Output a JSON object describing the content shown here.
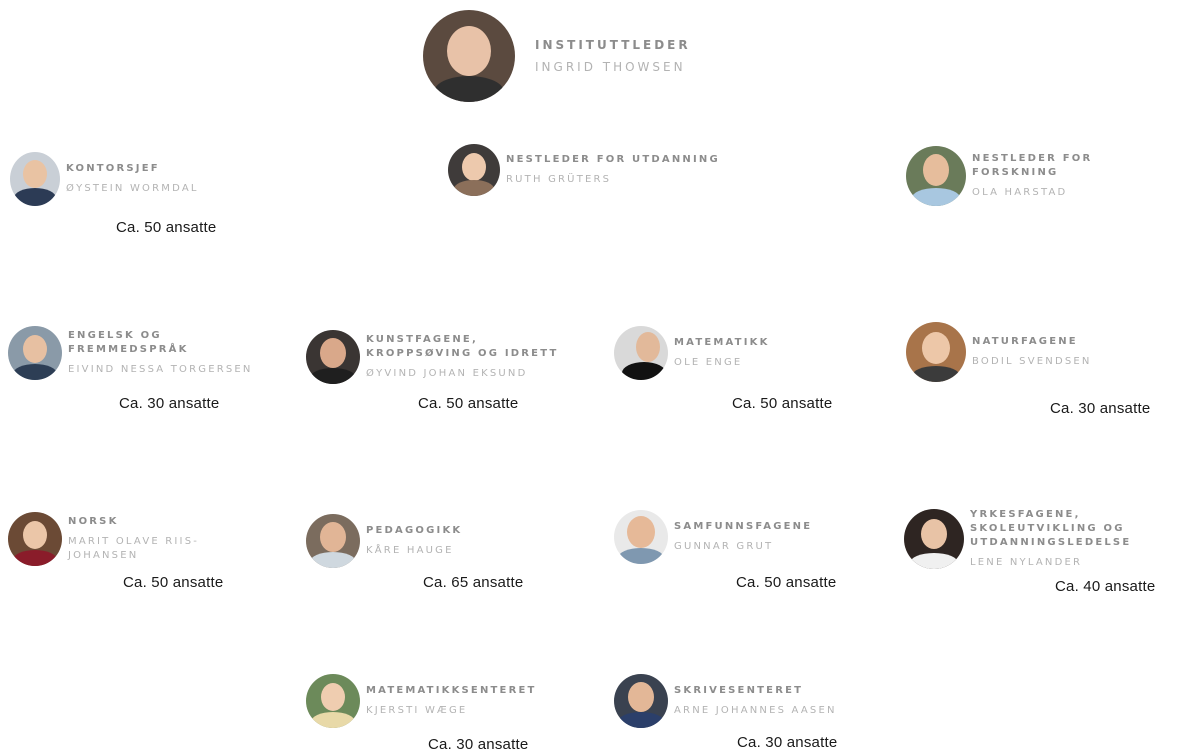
{
  "head": {
    "role": "INSTITUTTLEDER",
    "name": "INGRID THOWSEN",
    "avatar_icon": "person-photo-icon"
  },
  "leaders": [
    {
      "role": "KONTORSJEF",
      "name": "ØYSTEIN WORMDAL",
      "count": "Ca. 50 ansatte"
    },
    {
      "role": "NESTLEDER FOR UTDANNING",
      "name": "RUTH GRÜTERS"
    },
    {
      "role": "NESTLEDER FOR\nFORSKNING",
      "name": "OLA HARSTAD"
    }
  ],
  "units": [
    {
      "role": "ENGELSK OG\nFREMMEDSPRÅK",
      "name": "EIVIND NESSA TORGERSEN",
      "count": "Ca. 30 ansatte"
    },
    {
      "role": "KUNSTFAGENE,\nKROPPSØVING OG IDRETT",
      "name": "ØYVIND JOHAN EKSUND",
      "count": "Ca. 50 ansatte"
    },
    {
      "role": "MATEMATIKK",
      "name": "OLE ENGE",
      "count": "Ca. 50 ansatte"
    },
    {
      "role": "NATURFAGENE",
      "name": "BODIL SVENDSEN",
      "count": "Ca. 30 ansatte"
    },
    {
      "role": "NORSK",
      "name": "MARIT OLAVE RIIS-\nJOHANSEN",
      "count": "Ca. 50 ansatte"
    },
    {
      "role": "PEDAGOGIKK",
      "name": "KÅRE HAUGE",
      "count": "Ca. 65 ansatte"
    },
    {
      "role": "SAMFUNNSFAGENE",
      "name": "GUNNAR GRUT",
      "count": "Ca. 50 ansatte"
    },
    {
      "role": "YRKESFAGENE,\nSKOLEUTVIKLING OG\nUTDANNINGSLEDELSE",
      "name": "LENE NYLANDER",
      "count": "Ca. 40 ansatte"
    },
    {
      "role": "MATEMATIKKSENTERET",
      "name": "KJERSTI WÆGE",
      "count": "Ca. 30 ansatte"
    },
    {
      "role": "SKRIVESENTERET",
      "name": "ARNE JOHANNES AASEN",
      "count": "Ca. 30 ansatte"
    }
  ],
  "colors": {
    "role_text": "#8c8c8c",
    "name_text": "#b3b3b3",
    "count_text": "#1a1a1a"
  }
}
